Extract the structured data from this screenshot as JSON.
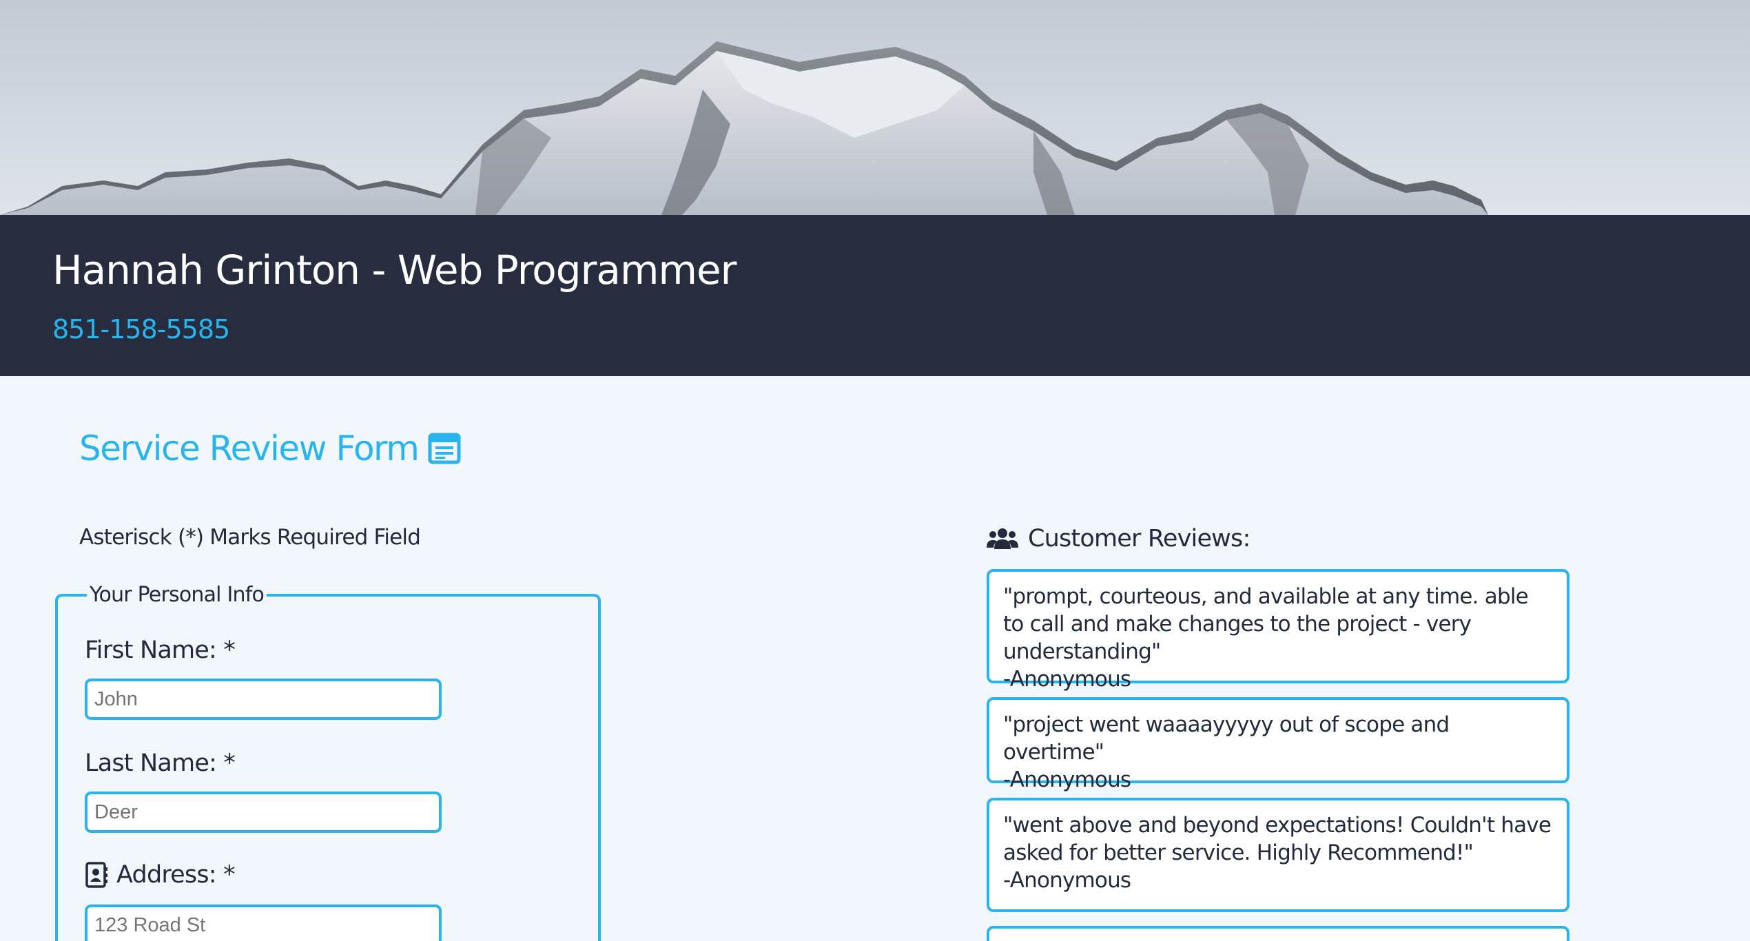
{
  "header": {
    "title": "Hannah Grinton - Web Programmer",
    "phone": "851-158-5585"
  },
  "form": {
    "heading": "Service Review Form",
    "heading_icon": "form-icon",
    "required_note": "Asterisck (*) Marks Required Field",
    "fieldset_legend": "Your Personal Info",
    "fields": [
      {
        "label": "First Name: *",
        "placeholder": "John",
        "value": ""
      },
      {
        "label": "Last Name: *",
        "placeholder": "Deer",
        "value": ""
      },
      {
        "label": "Address: *",
        "placeholder": "123 Road St",
        "value": "",
        "icon": "address-book-icon"
      }
    ]
  },
  "reviews": {
    "heading": "Customer Reviews:",
    "heading_icon": "users-icon",
    "items": [
      {
        "quote": "\"prompt, courteous, and available at any time. able to call and make changes to the project - very understanding\"",
        "author": "-Anonymous"
      },
      {
        "quote": "\"project went waaaayyyyy out of scope and overtime\"",
        "author": "-Anonymous"
      },
      {
        "quote": "\"went above and beyond expectations! Couldn't have asked for better service. Highly Recommend!\"",
        "author": "-Anonymous"
      }
    ]
  },
  "colors": {
    "header_bg": "#272c3e",
    "accent": "#2ab4ee",
    "page_bg": "#f1f7fc",
    "text": "#232a3c"
  }
}
